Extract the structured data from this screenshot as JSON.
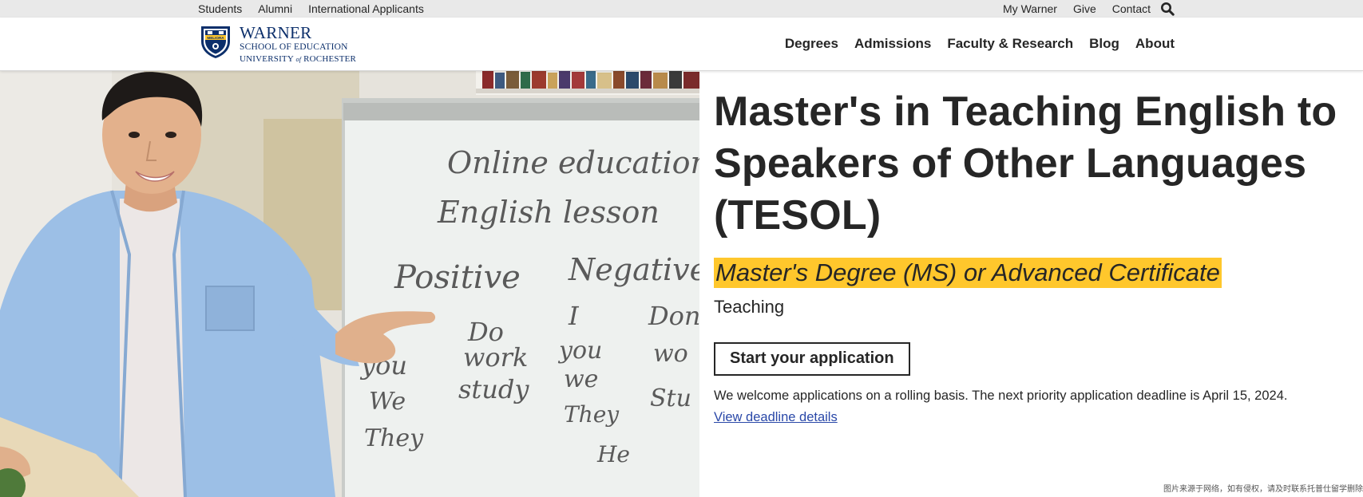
{
  "utility_nav": {
    "left": [
      "Students",
      "Alumni",
      "International Applicants"
    ],
    "right": [
      "My Warner",
      "Give",
      "Contact"
    ],
    "search_icon": "search-icon"
  },
  "logo": {
    "name": "WARNER",
    "school": "SCHOOL OF EDUCATION",
    "university_pre": "UNIVERSITY ",
    "university_of": "of",
    "university_post": " ROCHESTER",
    "seal_text": "MELIORA",
    "seal_icon": "university-seal-icon"
  },
  "main_nav": [
    "Degrees",
    "Admissions",
    "Faculty & Research",
    "Blog",
    "About"
  ],
  "hero": {
    "title": "Master's in Teaching English to Speakers of Other Languages (TESOL)",
    "subtitle": "Master's Degree (MS) or Advanced Certificate",
    "category": "Teaching",
    "apply_label": "Start your application",
    "deadline_text": "We welcome applications on a rolling basis. The next priority application deadline is April 15, 2024.",
    "deadline_link": "View deadline details",
    "whiteboard_lines": [
      "Online education",
      "English lesson",
      "Positive",
      "Negative",
      "Do",
      "I",
      "Don",
      "you",
      "work",
      "you",
      "wo",
      "We",
      "study",
      "we",
      "Stu",
      "They",
      "They",
      "He"
    ]
  },
  "watermark": "图片来源于网络，如有侵权，请及时联系托普仕留学删除",
  "colors": {
    "highlight": "#ffc72c",
    "brand_navy": "#0c2f6b",
    "link": "#2a48a8",
    "utility_bg": "#e9e9e9"
  }
}
